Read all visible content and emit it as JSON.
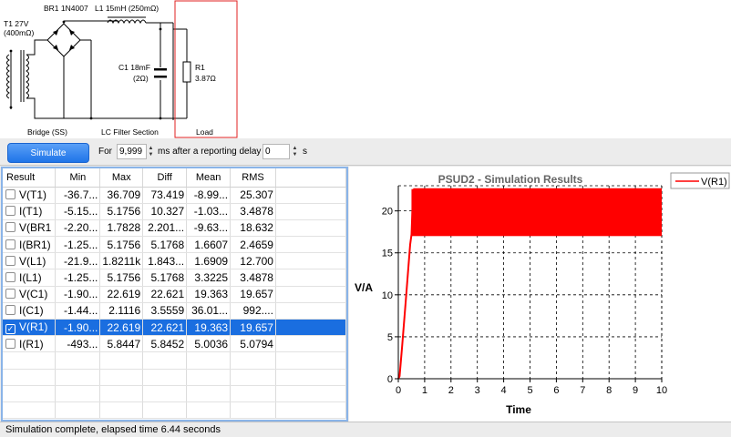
{
  "schematic": {
    "transformer_label": "T1 27V",
    "transformer_resistance": "(400mΩ)",
    "rectifier_label": "BR1 1N4007",
    "inductor_label": "L1 15mH (250mΩ)",
    "capacitor_label": "C1 18mF",
    "capacitor_resistance": "(2Ω)",
    "resistor_label": "R1",
    "resistor_value": "3.87Ω",
    "section_bridge": "Bridge (SS)",
    "section_filter": "LC Filter Section",
    "section_load": "Load"
  },
  "toolbar": {
    "simulate_label": "Simulate",
    "for_label": "For",
    "duration_value": "9,999",
    "after_label": "ms after a reporting delay",
    "delay_value": "0",
    "unit_label": "s"
  },
  "table": {
    "headers": [
      "Result",
      "Min",
      "Max",
      "Diff",
      "Mean",
      "RMS"
    ],
    "rows": [
      {
        "name": "V(T1)",
        "checked": false,
        "min": "-36.7...",
        "max": "36.709",
        "diff": "73.419",
        "mean": "-8.99...",
        "rms": "25.307"
      },
      {
        "name": "I(T1)",
        "checked": false,
        "min": "-5.15...",
        "max": "5.1756",
        "diff": "10.327",
        "mean": "-1.03...",
        "rms": "3.4878"
      },
      {
        "name": "V(BR1",
        "checked": false,
        "min": "-2.20...",
        "max": "1.7828",
        "diff": "2.201...",
        "mean": "-9.63...",
        "rms": "18.632"
      },
      {
        "name": "I(BR1)",
        "checked": false,
        "min": "-1.25...",
        "max": "5.1756",
        "diff": "5.1768",
        "mean": "1.6607",
        "rms": "2.4659"
      },
      {
        "name": "V(L1)",
        "checked": false,
        "min": "-21.9...",
        "max": "1.8211k",
        "diff": "1.843...",
        "mean": "1.6909",
        "rms": "12.700"
      },
      {
        "name": "I(L1)",
        "checked": false,
        "min": "-1.25...",
        "max": "5.1756",
        "diff": "5.1768",
        "mean": "3.3225",
        "rms": "3.4878"
      },
      {
        "name": "V(C1)",
        "checked": false,
        "min": "-1.90...",
        "max": "22.619",
        "diff": "22.621",
        "mean": "19.363",
        "rms": "19.657"
      },
      {
        "name": "I(C1)",
        "checked": false,
        "min": "-1.44...",
        "max": "2.1116",
        "diff": "3.5559",
        "mean": "36.01...",
        "rms": "992...."
      },
      {
        "name": "V(R1)",
        "checked": true,
        "selected": true,
        "min": "-1.90...",
        "max": "22.619",
        "diff": "22.621",
        "mean": "19.363",
        "rms": "19.657"
      },
      {
        "name": "I(R1)",
        "checked": false,
        "min": "-493...",
        "max": "5.8447",
        "diff": "5.8452",
        "mean": "5.0036",
        "rms": "5.0794"
      }
    ],
    "empty_rows": 4
  },
  "chart_data": {
    "type": "line",
    "title": "PSUD2 - Simulation Results",
    "xlabel": "Time",
    "ylabel": "V/A",
    "xlim": [
      0,
      10
    ],
    "ylim": [
      0,
      23
    ],
    "xticks": [
      0,
      1,
      2,
      3,
      4,
      5,
      6,
      7,
      8,
      9,
      10
    ],
    "yticks": [
      0,
      5,
      10,
      15,
      20
    ],
    "grid": true,
    "legend_position": "top-right",
    "series": [
      {
        "name": "V(R1)",
        "color": "#ff0000",
        "ripple_min": 17.0,
        "ripple_max": 22.6,
        "points": [
          [
            0,
            0
          ],
          [
            0.05,
            0.3
          ],
          [
            0.15,
            4
          ],
          [
            0.3,
            10
          ],
          [
            0.45,
            16
          ],
          [
            0.5,
            17.2
          ],
          [
            0.55,
            21.5
          ],
          [
            0.6,
            22.6
          ],
          [
            10,
            22.6
          ]
        ]
      }
    ]
  },
  "status": {
    "text": "Simulation complete, elapsed time 6.44 seconds"
  }
}
